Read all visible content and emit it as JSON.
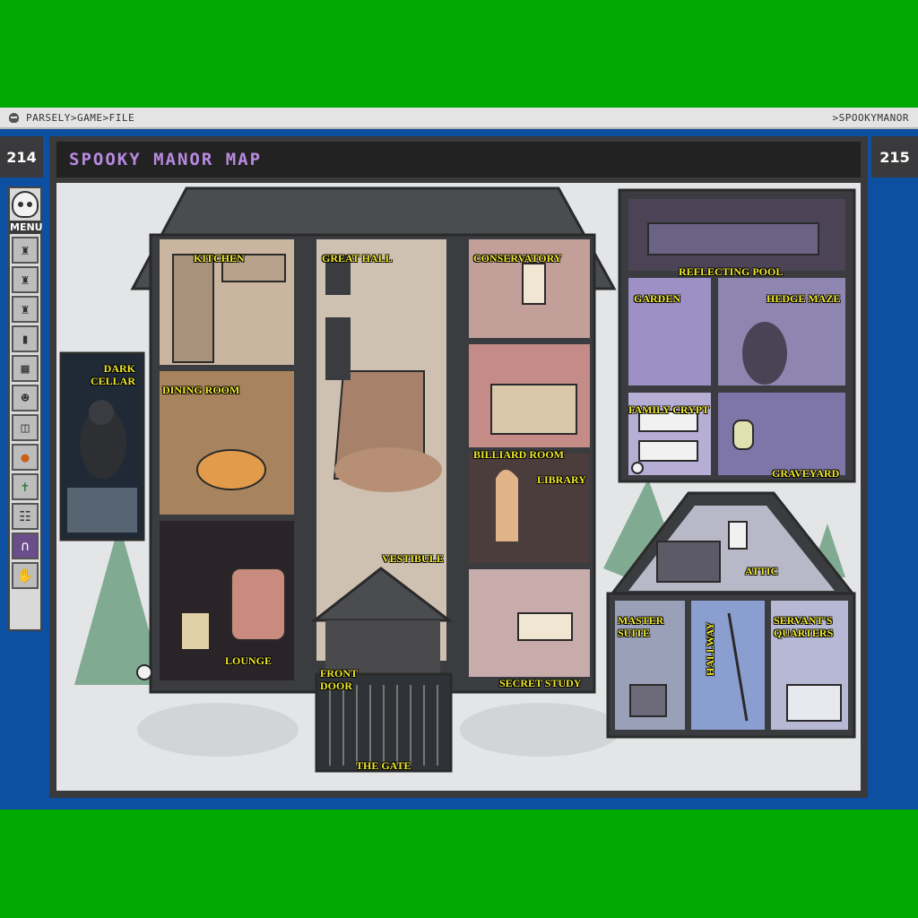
{
  "titlebar": {
    "path": "PARSELY>GAME>FILE",
    "game": ">SPOOKYMANOR"
  },
  "pages": {
    "left": "214",
    "right": "215"
  },
  "sidebar": {
    "menu_label": "MENU",
    "icons": [
      "tower-icon",
      "castle-icon",
      "castle-keep-icon",
      "door-icon",
      "city-icon",
      "goat-icon",
      "tombstone-icon",
      "pumpkin-icon",
      "cactus-icon",
      "gate-icon",
      "arch-icon",
      "hand-icon"
    ]
  },
  "window": {
    "title": "SPOOKY MANOR MAP"
  },
  "rooms": {
    "kitchen": "KITCHEN",
    "great_hall": "GREAT HALL",
    "conservatory": "CONSERVATORY",
    "dark_cellar": "DARK\nCELLAR",
    "dining_room": "DINING ROOM",
    "billiard_room": "BILLIARD ROOM",
    "library": "LIBRARY",
    "vestibule": "VESTIBULE",
    "lounge": "LOUNGE",
    "front_door": "FRONT\nDOOR",
    "secret_study": "SECRET STUDY",
    "the_gate": "THE GATE",
    "reflecting_pool": "REFLECTING POOL",
    "garden": "GARDEN",
    "hedge_maze": "HEDGE MAZE",
    "family_crypt": "FAMILY CRYPT",
    "graveyard": "GRAVEYARD",
    "attic": "ATTIC",
    "master_suite": "MASTER\nSUITE",
    "hallway": "HALLWAY",
    "servants_quarters": "SERVANT'S\nQUARTERS"
  },
  "colors": {
    "green": "#00a800",
    "blue": "#0d4fa0",
    "label": "#f1e92a",
    "title": "#b78ae0"
  }
}
